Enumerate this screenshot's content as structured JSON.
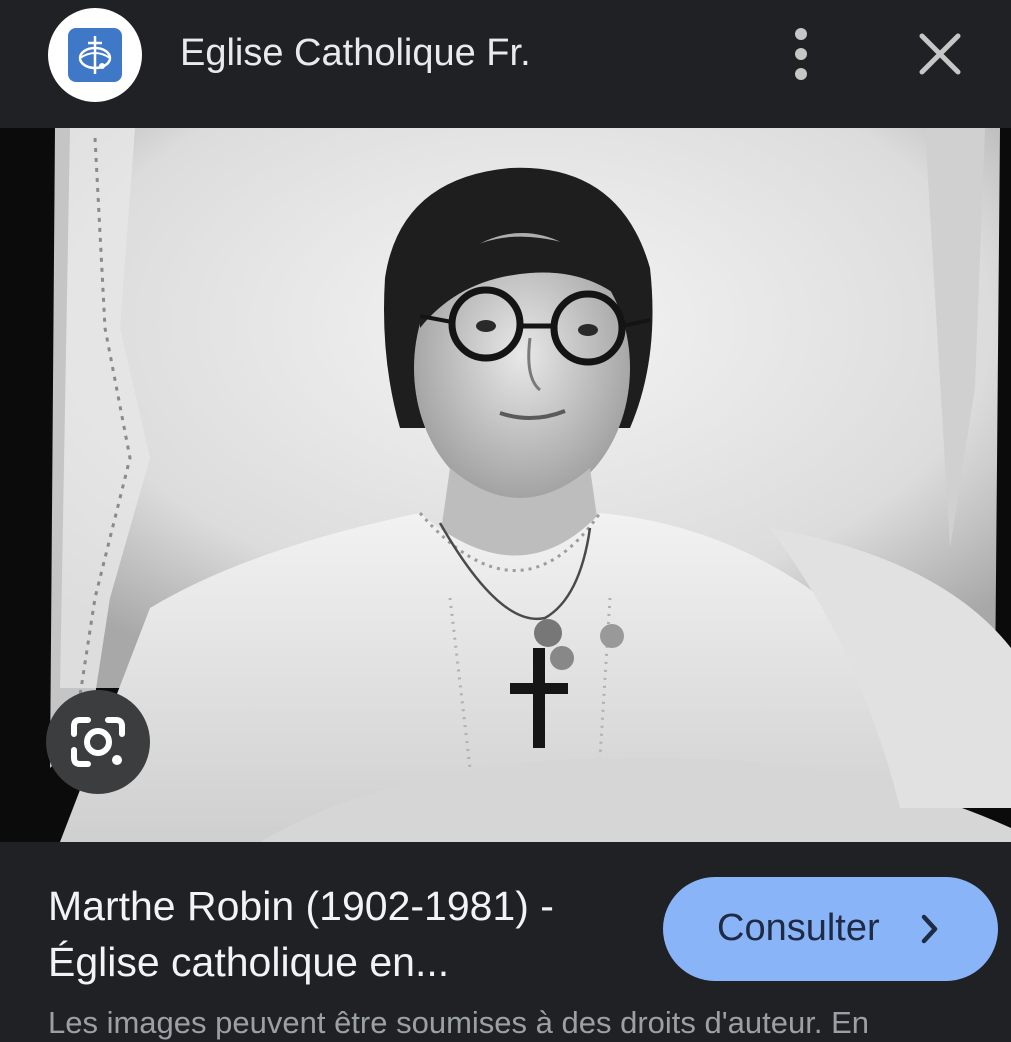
{
  "header": {
    "site_name": "Eglise Catholique Fr.",
    "logo_icon": "eglise-catholique-logo-icon",
    "more_icon": "more-vert-icon",
    "close_icon": "close-icon"
  },
  "image": {
    "lens_icon": "google-lens-icon"
  },
  "result": {
    "title": "Marthe Robin (1902-1981) - Église catholique en...",
    "button_label": "Consulter",
    "button_icon": "chevron-right-icon",
    "disclaimer": "Les images peuvent être soumises à des droits d'auteur. En"
  },
  "colors": {
    "background": "#202124",
    "accent": "#8ab4f8",
    "logo_blue": "#3f78c6"
  }
}
